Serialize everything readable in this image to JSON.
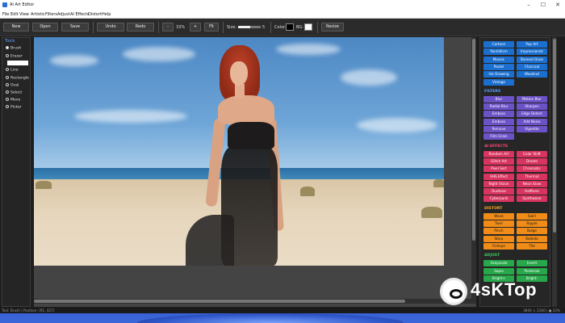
{
  "window": {
    "title": "AI Art Editor"
  },
  "menu": [
    "File",
    "Edit",
    "View",
    "Artistic",
    "Filters",
    "Adjust",
    "AI Effects",
    "Distort",
    "Help"
  ],
  "toolbar": {
    "new": "New",
    "open": "Open",
    "save": "Save",
    "undo": "Undo",
    "redo": "Redo",
    "zoom_out": "-",
    "zoom_value": "33%",
    "zoom_in": "+",
    "fit": "Fit",
    "size_label": "Size:",
    "size_value": "5",
    "size_level": 0.55,
    "color_label": "Color:",
    "bg_label": "BG:",
    "fg_color": "#000000",
    "bg_color": "#ffffff",
    "resize": "Resize"
  },
  "tools": {
    "header": "Tools",
    "items": [
      "Brush",
      "Eraser",
      "Line",
      "Rectangle",
      "Oval",
      "Select",
      "Move",
      "Picker"
    ],
    "selected": "Brush"
  },
  "effects": {
    "artistic": [
      "Cartoon",
      "Pop Art",
      "Pointillism",
      "Impressionist",
      "Mosaic",
      "Stained Glass",
      "Pastel",
      "Charcoal",
      "Ink Drawing",
      "Woodcut",
      "Vintage"
    ],
    "filters_title": "FILTERS",
    "filters": [
      "Blur",
      "Motion Blur",
      "Radial Blur",
      "Sharpen",
      "Emboss",
      "Edge Detect",
      "Emboss",
      "Add Noise",
      "Remove",
      "Vignette",
      "Film Grain"
    ],
    "ai_title": "AI EFFECTS",
    "ai": [
      "Random Art",
      "Color Shift",
      "Glitch Art",
      "Dream",
      "Pixel Sort",
      "Chromatic",
      "VHS Effect",
      "Thermal",
      "Night Vision",
      "Neon Glow",
      "Duotone",
      "Halftone",
      "Cyberpunk",
      "Synthwave"
    ],
    "distort_title": "DISTORT",
    "distort": [
      "Wave",
      "Swirl",
      "Twirl",
      "Ripple",
      "Pinch",
      "Bulge",
      "Warp",
      "Kaleido",
      "Fisheye",
      "Tile"
    ],
    "adjust_title": "ADJUST",
    "adjust": [
      "Grayscale",
      "Invert",
      "Sepia",
      "Posterize",
      "Bright+",
      "Bright-"
    ]
  },
  "colors": {
    "section_filters": "#5aa0ff",
    "section_ai": "#ff4d7a",
    "section_distort": "#f5a623",
    "section_adjust": "#3ecb60"
  },
  "status": {
    "left": "Tool: Brush | Position: (91, 427)",
    "right": "3840 × 2160 | ● 33%"
  },
  "watermark": {
    "text": "4sKTop"
  }
}
